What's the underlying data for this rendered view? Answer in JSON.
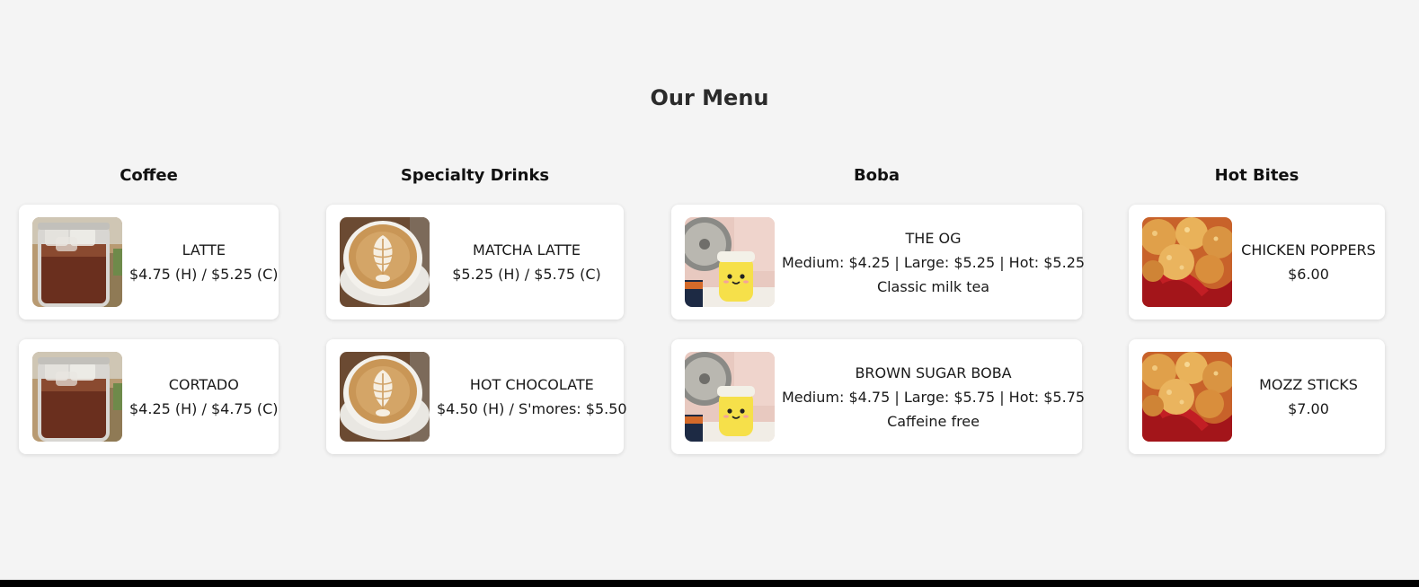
{
  "menu_title": "Our Menu",
  "categories": [
    {
      "title": "Coffee",
      "items": [
        {
          "name": "LATTE",
          "price": "$4.75 (H) / $5.25 (C)",
          "image": "iced-coffee-image"
        },
        {
          "name": "CORTADO",
          "price": "$4.25 (H) / $4.75 (C)",
          "image": "iced-coffee-image"
        }
      ]
    },
    {
      "title": "Specialty Drinks",
      "items": [
        {
          "name": "MATCHA LATTE",
          "price": "$5.25 (H) / $5.75 (C)",
          "image": "latte-art-image"
        },
        {
          "name": "HOT CHOCOLATE",
          "price": "$4.50 (H) / S'mores: $5.50",
          "image": "latte-art-image"
        }
      ]
    },
    {
      "title": "Boba",
      "items": [
        {
          "name": "THE OG",
          "price": "Medium: $4.25 | Large: $5.25 | Hot: $5.25",
          "description": "Classic milk tea",
          "image": "boba-cup-image"
        },
        {
          "name": "BROWN SUGAR BOBA",
          "price": "Medium: $4.75 | Large: $5.75 | Hot: $5.75",
          "description": "Caffeine free",
          "image": "boba-cup-image"
        }
      ]
    },
    {
      "title": "Hot Bites",
      "items": [
        {
          "name": "CHICKEN POPPERS",
          "price": "$6.00",
          "image": "fried-bites-image"
        },
        {
          "name": "MOZZ STICKS",
          "price": "$7.00",
          "image": "fried-bites-image"
        }
      ]
    }
  ]
}
